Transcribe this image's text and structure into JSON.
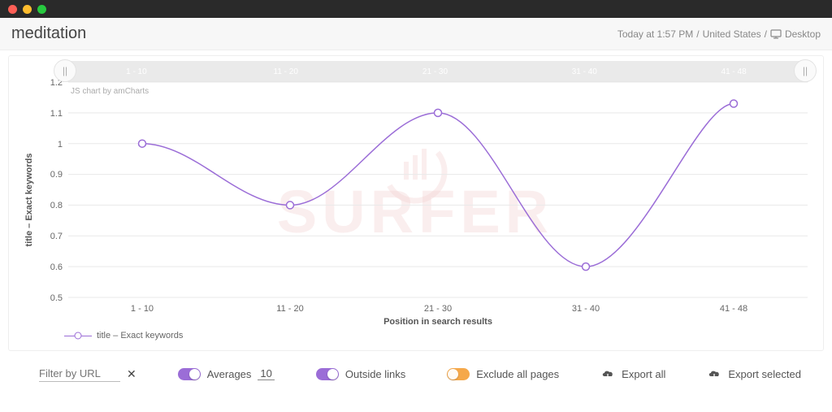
{
  "header": {
    "title": "meditation",
    "meta_time": "Today at 1:57 PM",
    "meta_country": "United States",
    "meta_device": "Desktop"
  },
  "chart_data": {
    "type": "line",
    "title": "",
    "xlabel": "Position in search results",
    "ylabel": "title – Exact keywords",
    "categories": [
      "1 - 10",
      "11 - 20",
      "21 - 30",
      "31 - 40",
      "41 - 48"
    ],
    "series": [
      {
        "name": "title – Exact keywords",
        "values": [
          1.0,
          0.8,
          1.1,
          0.6,
          1.13
        ]
      }
    ],
    "ylim": [
      0.5,
      1.2
    ],
    "yticks": [
      0.5,
      0.6,
      0.7,
      0.8,
      0.9,
      1.0,
      1.1,
      1.2
    ],
    "credit": "JS chart by amCharts",
    "watermark": "SURFER"
  },
  "legend": {
    "label": "title – Exact keywords"
  },
  "toolbar": {
    "filter_placeholder": "Filter by URL",
    "averages_label": "Averages",
    "averages_value": "10",
    "outside_label": "Outside links",
    "exclude_label": "Exclude all pages",
    "export_all": "Export all",
    "export_selected": "Export selected"
  }
}
